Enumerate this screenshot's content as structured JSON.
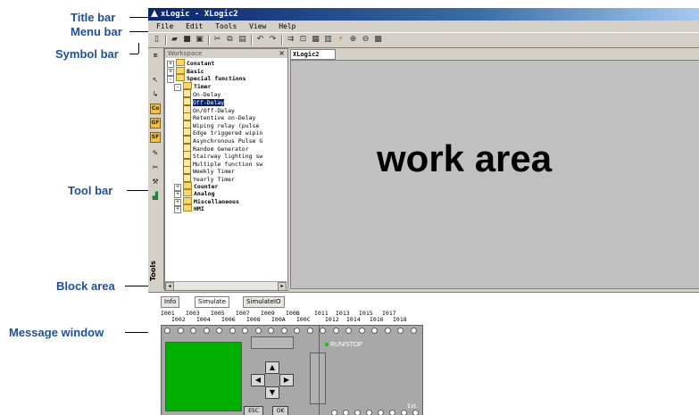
{
  "callouts": {
    "title_bar": "Title bar",
    "menu_bar": "Menu bar",
    "symbol_bar": "Symbol bar",
    "tool_bar": "Tool bar",
    "block_area": "Block area",
    "message_window": "Message window"
  },
  "window": {
    "title": "xLogic - XLogic2"
  },
  "menu": {
    "items": [
      "File",
      "Edit",
      "Tools",
      "View",
      "Help"
    ]
  },
  "toolbar": {
    "icons": [
      "new-icon",
      "open-icon",
      "save-icon",
      "save-all-icon",
      "cut-icon",
      "copy-icon",
      "paste-icon",
      "undo-icon",
      "redo-icon",
      "connect-icon",
      "zoom-fit-icon",
      "simulate-icon",
      "print-icon",
      "flash-icon",
      "zoom-in-icon",
      "zoom-out-icon",
      "grid-icon"
    ]
  },
  "tools": {
    "label": "Tools",
    "items": [
      "Co",
      "GF",
      "SF"
    ]
  },
  "workspace": {
    "title": "Workspace",
    "tree": [
      {
        "label": "Constant",
        "level": 0,
        "type": "folder",
        "expander": "+"
      },
      {
        "label": "Basic",
        "level": 0,
        "type": "folder",
        "expander": "+"
      },
      {
        "label": "Special functions",
        "level": 0,
        "type": "folder",
        "expander": "-"
      },
      {
        "label": "Timer",
        "level": 1,
        "type": "folder",
        "expander": "-"
      },
      {
        "label": "On-Delay",
        "level": 2,
        "type": "item"
      },
      {
        "label": "Off-Delay",
        "level": 2,
        "type": "item",
        "selected": true
      },
      {
        "label": "On/Off-Delay",
        "level": 2,
        "type": "item"
      },
      {
        "label": "Retentive on-Delay",
        "level": 2,
        "type": "item"
      },
      {
        "label": "Wiping relay (pulse",
        "level": 2,
        "type": "item"
      },
      {
        "label": "Edge triggered wipin",
        "level": 2,
        "type": "item"
      },
      {
        "label": "Asynchronous Pulse G",
        "level": 2,
        "type": "item"
      },
      {
        "label": "Random Generator",
        "level": 2,
        "type": "item"
      },
      {
        "label": "Stairway lighting sw",
        "level": 2,
        "type": "item"
      },
      {
        "label": "Multiple function sw",
        "level": 2,
        "type": "item"
      },
      {
        "label": "Weekly Timer",
        "level": 2,
        "type": "item"
      },
      {
        "label": "Yearly Timer",
        "level": 2,
        "type": "item"
      },
      {
        "label": "Counter",
        "level": 1,
        "type": "folder",
        "expander": "+"
      },
      {
        "label": "Analog",
        "level": 1,
        "type": "folder",
        "expander": "+"
      },
      {
        "label": "Miscellaneous",
        "level": 1,
        "type": "folder",
        "expander": "+"
      },
      {
        "label": "HMI",
        "level": 1,
        "type": "folder",
        "expander": "+"
      }
    ]
  },
  "editor": {
    "tab": "XLogic2",
    "canvas_label": "work area"
  },
  "message": {
    "tabs": [
      "Info",
      "Simulate",
      "SimulateIO"
    ],
    "active_tab": "Simulate",
    "io_top": [
      "I001",
      "I003",
      "I005",
      "I007",
      "I009",
      "I00B",
      "I011",
      "I013",
      "I015",
      "I017"
    ],
    "io_bottom": [
      "I002",
      "I004",
      "I006",
      "I008",
      "I00A",
      "I00C",
      "I012",
      "I014",
      "I016",
      "I018"
    ],
    "buttons": {
      "esc": "ESC",
      "ok": "OK"
    },
    "run_stop": "RUN/STOP",
    "ext": "Ext."
  },
  "colors": {
    "callout_text": "#1f4f9a",
    "lcd": "#00b000",
    "canvas": "#c0c0c0",
    "chrome": "#d4d0c8"
  }
}
